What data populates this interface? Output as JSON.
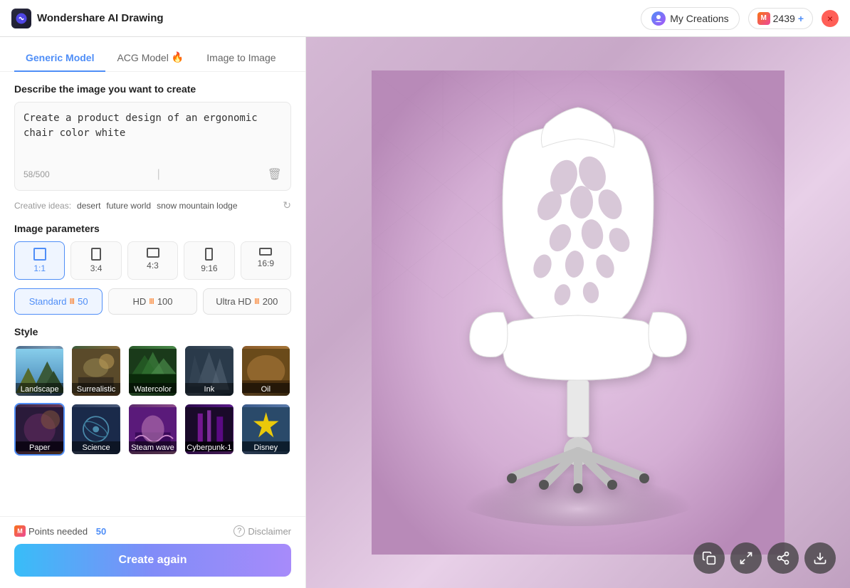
{
  "app": {
    "title": "Wondershare AI Drawing",
    "close_label": "×"
  },
  "header": {
    "my_creations_label": "My Creations",
    "points_value": "2439",
    "add_label": "+"
  },
  "tabs": [
    {
      "id": "generic",
      "label": "Generic Model",
      "active": true,
      "fire": false
    },
    {
      "id": "acg",
      "label": "ACG Model",
      "active": false,
      "fire": true
    },
    {
      "id": "image2image",
      "label": "Image to Image",
      "active": false,
      "fire": false
    }
  ],
  "prompt": {
    "section_label": "Describe the image you want to create",
    "value": "Create a product design of an ergonomic chair color white",
    "char_count": "58/500"
  },
  "creative_ideas": {
    "label": "Creative ideas:",
    "tags": [
      "desert",
      "future world",
      "snow mountain lodge"
    ]
  },
  "image_parameters": {
    "section_label": "Image parameters",
    "ratios": [
      {
        "id": "1:1",
        "label": "1:1",
        "active": true
      },
      {
        "id": "3:4",
        "label": "3:4",
        "active": false
      },
      {
        "id": "4:3",
        "label": "4:3",
        "active": false
      },
      {
        "id": "9:16",
        "label": "9:16",
        "active": false
      },
      {
        "id": "16:9",
        "label": "16:9",
        "active": false
      }
    ],
    "quality": [
      {
        "id": "standard",
        "label": "Standard",
        "points": "50",
        "active": true
      },
      {
        "id": "hd",
        "label": "HD",
        "points": "100",
        "active": false
      },
      {
        "id": "ultrahd",
        "label": "Ultra HD",
        "points": "200",
        "active": false
      }
    ]
  },
  "style": {
    "section_label": "Style",
    "items": [
      {
        "id": "landscape",
        "label": "Landscape",
        "class": "style-landscape",
        "active": false
      },
      {
        "id": "surrealistic",
        "label": "Surrealistic",
        "class": "style-surrealistic",
        "active": false
      },
      {
        "id": "watercolor",
        "label": "Watercolor",
        "class": "style-watercolor",
        "active": false
      },
      {
        "id": "ink",
        "label": "Ink",
        "class": "style-ink",
        "active": false
      },
      {
        "id": "oil",
        "label": "Oil",
        "class": "style-oil",
        "active": false
      },
      {
        "id": "paper",
        "label": "Paper",
        "class": "style-paper",
        "active": true
      },
      {
        "id": "science",
        "label": "Science",
        "class": "style-science",
        "active": false
      },
      {
        "id": "steam-wave",
        "label": "Steam wave",
        "class": "style-steam",
        "active": false
      },
      {
        "id": "cyberpunk-1",
        "label": "Cyberpunk-1",
        "class": "style-cyberpunk",
        "active": false
      },
      {
        "id": "disney",
        "label": "Disney",
        "class": "style-disney",
        "active": false
      }
    ]
  },
  "bottom": {
    "points_needed_label": "Points needed",
    "points_value": "50",
    "disclaimer_label": "Disclaimer",
    "create_btn_label": "Create again"
  },
  "toolbar": {
    "buttons": [
      {
        "id": "copy",
        "icon": "⊟",
        "label": "copy-icon"
      },
      {
        "id": "fullscreen",
        "icon": "⛶",
        "label": "fullscreen-icon"
      },
      {
        "id": "share",
        "icon": "↗",
        "label": "share-icon"
      },
      {
        "id": "download",
        "icon": "⬇",
        "label": "download-icon"
      }
    ]
  }
}
